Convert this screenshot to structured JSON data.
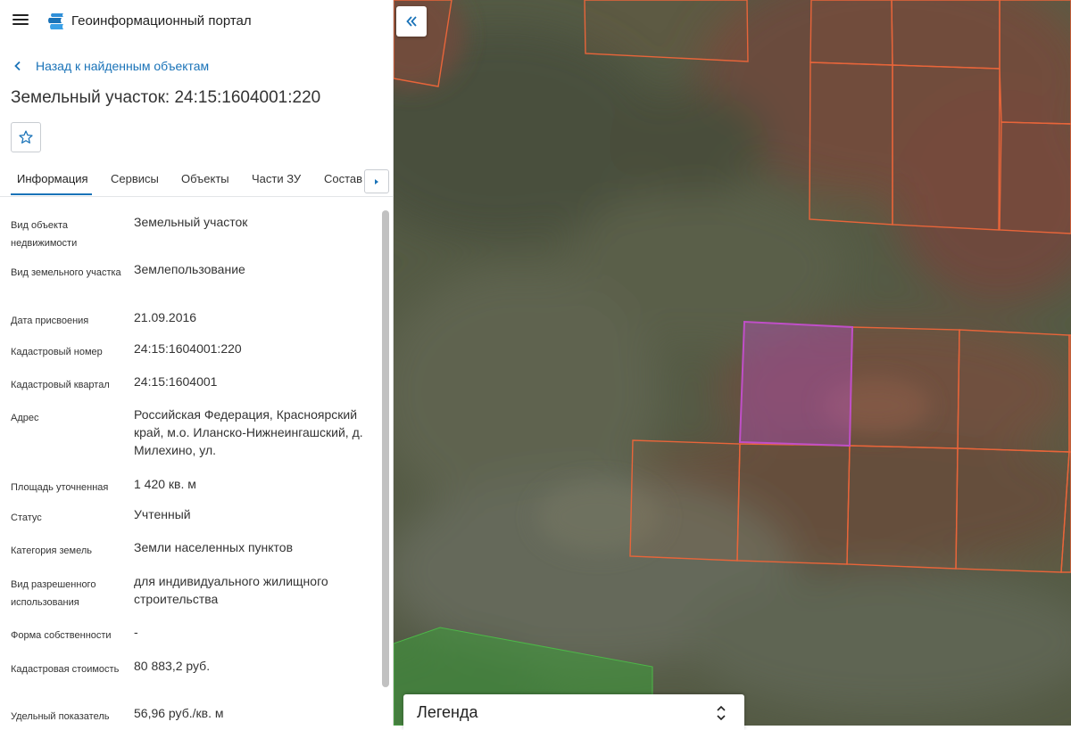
{
  "header": {
    "app_title": "Геоинформационный портал",
    "menu_icon": "hamburger-menu-icon",
    "logo_icon": "portal-logo-icon"
  },
  "back_link": {
    "label": "Назад к найденным объектам"
  },
  "page_title": "Земельный участок: 24:15:1604001:220",
  "tabs": [
    {
      "label": "Информация",
      "active": true
    },
    {
      "label": "Сервисы"
    },
    {
      "label": "Объекты"
    },
    {
      "label": "Части ЗУ"
    },
    {
      "label": "Состав"
    }
  ],
  "info": [
    {
      "label": "Вид объекта недвижимости",
      "value": "Земельный участок"
    },
    {
      "label": "Вид земельного участка",
      "value": "Землепользование"
    },
    {
      "label": "Дата присвоения",
      "value": "21.09.2016"
    },
    {
      "label": "Кадастровый номер",
      "value": "24:15:1604001:220"
    },
    {
      "label": "Кадастровый квартал",
      "value": "24:15:1604001"
    },
    {
      "label": "Адрес",
      "value": "Российская Федерация, Красноярский край, м.о. Иланско-Нижнеингашский, д. Милехино, ул."
    },
    {
      "label": "Площадь уточненная",
      "value": "1 420 кв. м"
    },
    {
      "label": "Статус",
      "value": "Учтенный"
    },
    {
      "label": "Категория земель",
      "value": "Земли населенных пунктов"
    },
    {
      "label": "Вид разрешенного использования",
      "value": "для индивидуального жилищного строительства"
    },
    {
      "label": "Форма собственности",
      "value": "-"
    },
    {
      "label": "Кадастровая стоимость",
      "value": "80 883,2 руб."
    },
    {
      "label": "Удельный показатель",
      "value": "56,96 руб./кв. м"
    }
  ],
  "map": {
    "legend_title": "Легенда",
    "parcel_color": "#e8653a",
    "selected_parcel_color": "#c04fc8",
    "zone_color": "#3f9a3c"
  },
  "colors": {
    "accent": "#1a73b8"
  }
}
